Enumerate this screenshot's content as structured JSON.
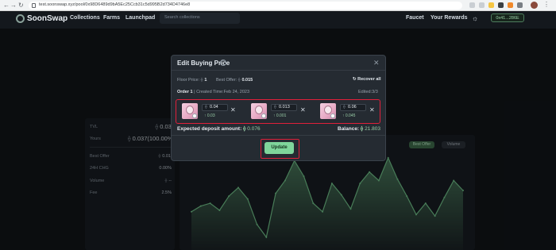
{
  "browser": {
    "url": "test.soonswap.xyz/pool/0x98D6489d9bA5Ec25Ccb31c5d995B2d734D4746e8",
    "back_icon": "arrow-left-icon",
    "forward_icon": "arrow-right-icon",
    "reload_icon": "reload-icon"
  },
  "header": {
    "brand": "SoonSwap",
    "nav": [
      "Collections",
      "Farms",
      "Launchpad"
    ],
    "search_placeholder": "Search collections",
    "faucet": "Faucet",
    "rewards": "Your Rewards",
    "wallet": "0x41...286E",
    "theme_icon": "sun-icon"
  },
  "background": {
    "tvl_label": "TVL",
    "tvl_value": "0.037",
    "yours_label": "Yours",
    "yours_value": "0.037(100.00%)",
    "best_offer_label": "Best Offer",
    "best_offer_value": "0.015",
    "change_label": "24H CHG",
    "change_value": "0.00%",
    "volume_label": "Volume",
    "volume_value": "--",
    "fee_label": "Fee",
    "fee_value": "2.5%",
    "chart_tabs": [
      "Best Offer",
      "Volume"
    ],
    "chart_active_tab": "Best Offer"
  },
  "chart_data": {
    "type": "area",
    "series": [
      {
        "values": [
          27,
          31,
          33,
          28,
          38,
          44,
          36,
          18,
          9,
          40,
          49,
          63,
          52,
          33,
          27,
          47,
          39,
          29,
          47,
          55,
          49,
          65,
          50,
          38,
          25,
          33,
          24,
          37,
          49,
          42
        ]
      }
    ],
    "ylim": [
      0,
      70
    ],
    "color": "#6fbf87"
  },
  "modal": {
    "title": "Edit Buying Price",
    "help_icon": "question-circle-icon",
    "close_icon": "close-icon",
    "floor_label": "Floor Price:",
    "floor_value": "1",
    "best_offer_label": "Best Offer:",
    "best_offer_value": "0.015",
    "recover_label": "Recover all",
    "order_label": "Order 1",
    "created_label": "| Created Time:Feb 24, 2023",
    "edited_label": "Edited:3/3",
    "items": [
      {
        "price": "0.04",
        "deposit": "0.03"
      },
      {
        "price": "0.013",
        "deposit": "0.001"
      },
      {
        "price": "0.06",
        "deposit": "0.045"
      }
    ],
    "expected_label": "Expected deposit amount:",
    "expected_value": "0.076",
    "balance_label": "Balance:",
    "balance_value": "21.803",
    "update_label": "Update"
  },
  "colors": {
    "accent": "#7fd59b",
    "highlight_outline": "#e0203a",
    "background": "#111418"
  }
}
